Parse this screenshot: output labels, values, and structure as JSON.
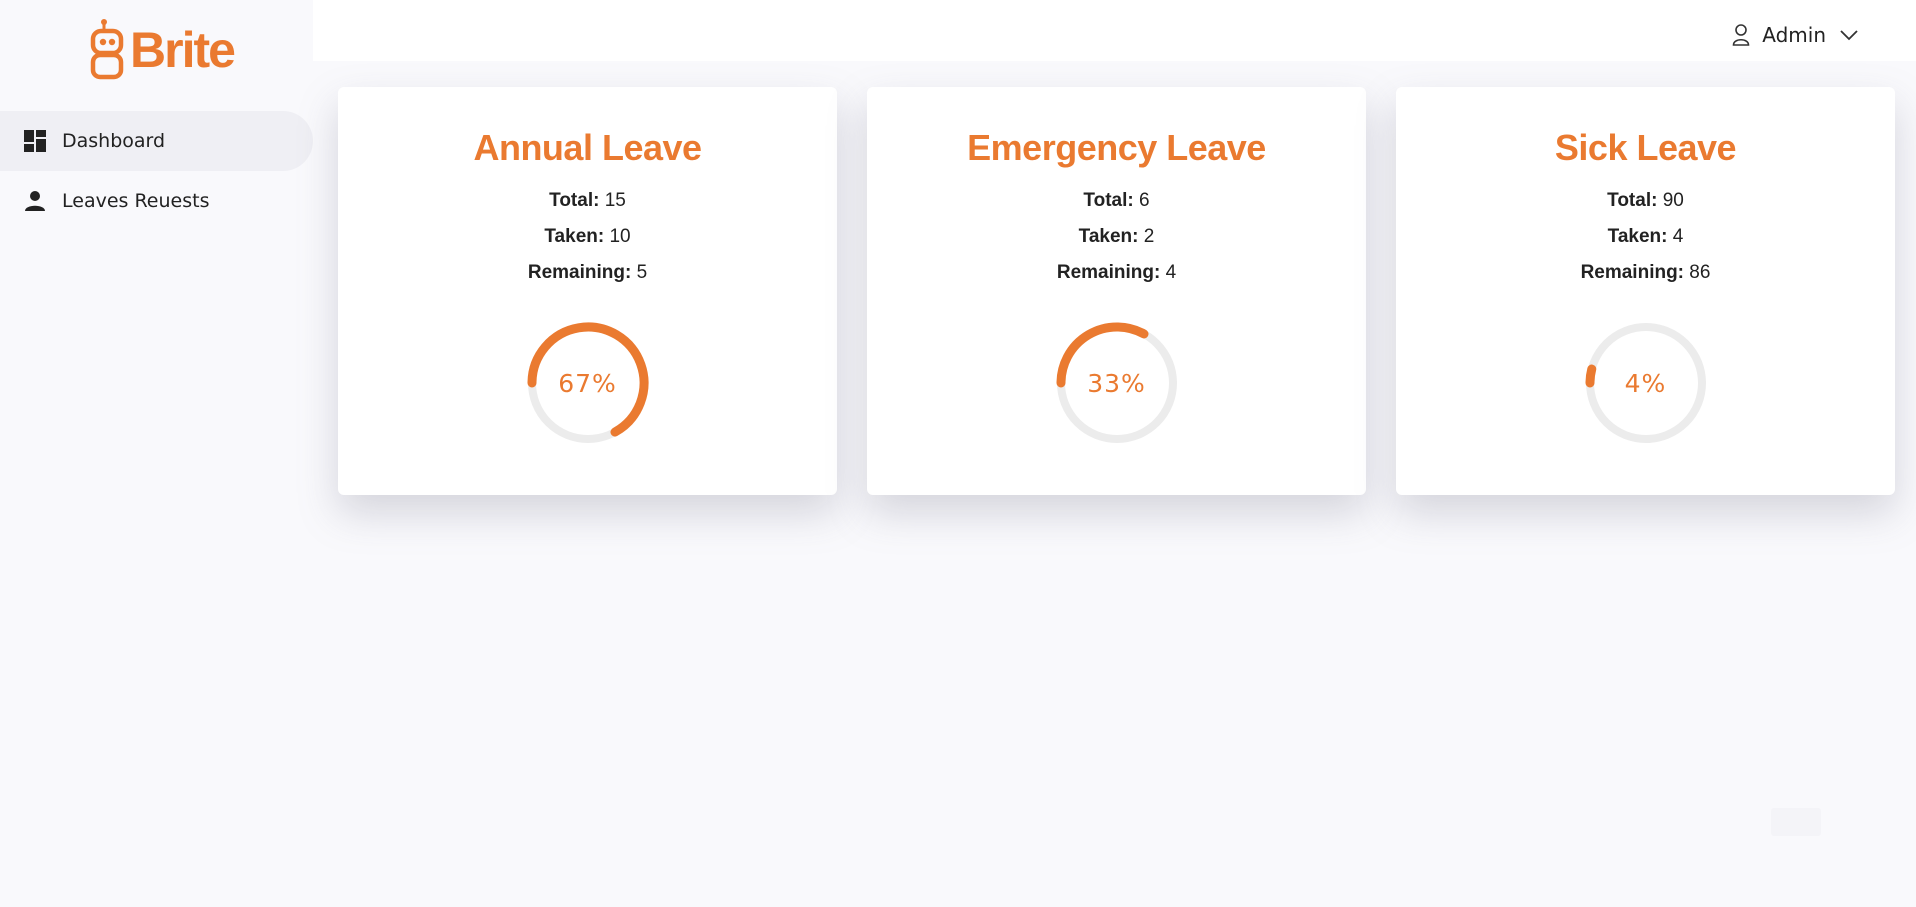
{
  "brand": {
    "name": "Brite",
    "color": "#ea7a30"
  },
  "sidebar": {
    "items": [
      {
        "label": "Dashboard",
        "icon": "dashboard-icon",
        "active": true
      },
      {
        "label": "Leaves Reuests",
        "icon": "person-icon",
        "active": false
      }
    ]
  },
  "header": {
    "user": {
      "label": "Admin",
      "icon": "user-outline-icon",
      "menu_icon": "chevron-down-icon"
    }
  },
  "cards": [
    {
      "title": "Annual Leave",
      "total_label": "Total:",
      "total": "15",
      "taken_label": "Taken:",
      "taken": "10",
      "remaining_label": "Remaining:",
      "remaining": "5",
      "percent_label": "67%",
      "percent": 0.67
    },
    {
      "title": "Emergency Leave",
      "total_label": "Total:",
      "total": "6",
      "taken_label": "Taken:",
      "taken": "2",
      "remaining_label": "Remaining:",
      "remaining": "4",
      "percent_label": "33%",
      "percent": 0.33
    },
    {
      "title": "Sick Leave",
      "total_label": "Total:",
      "total": "90",
      "taken_label": "Taken:",
      "taken": "4",
      "remaining_label": "Remaining:",
      "remaining": "86",
      "percent_label": "4%",
      "percent": 0.04
    }
  ],
  "colors": {
    "accent": "#ea7a30",
    "track": "#ececec",
    "sidebar_active": "#efeff4"
  }
}
